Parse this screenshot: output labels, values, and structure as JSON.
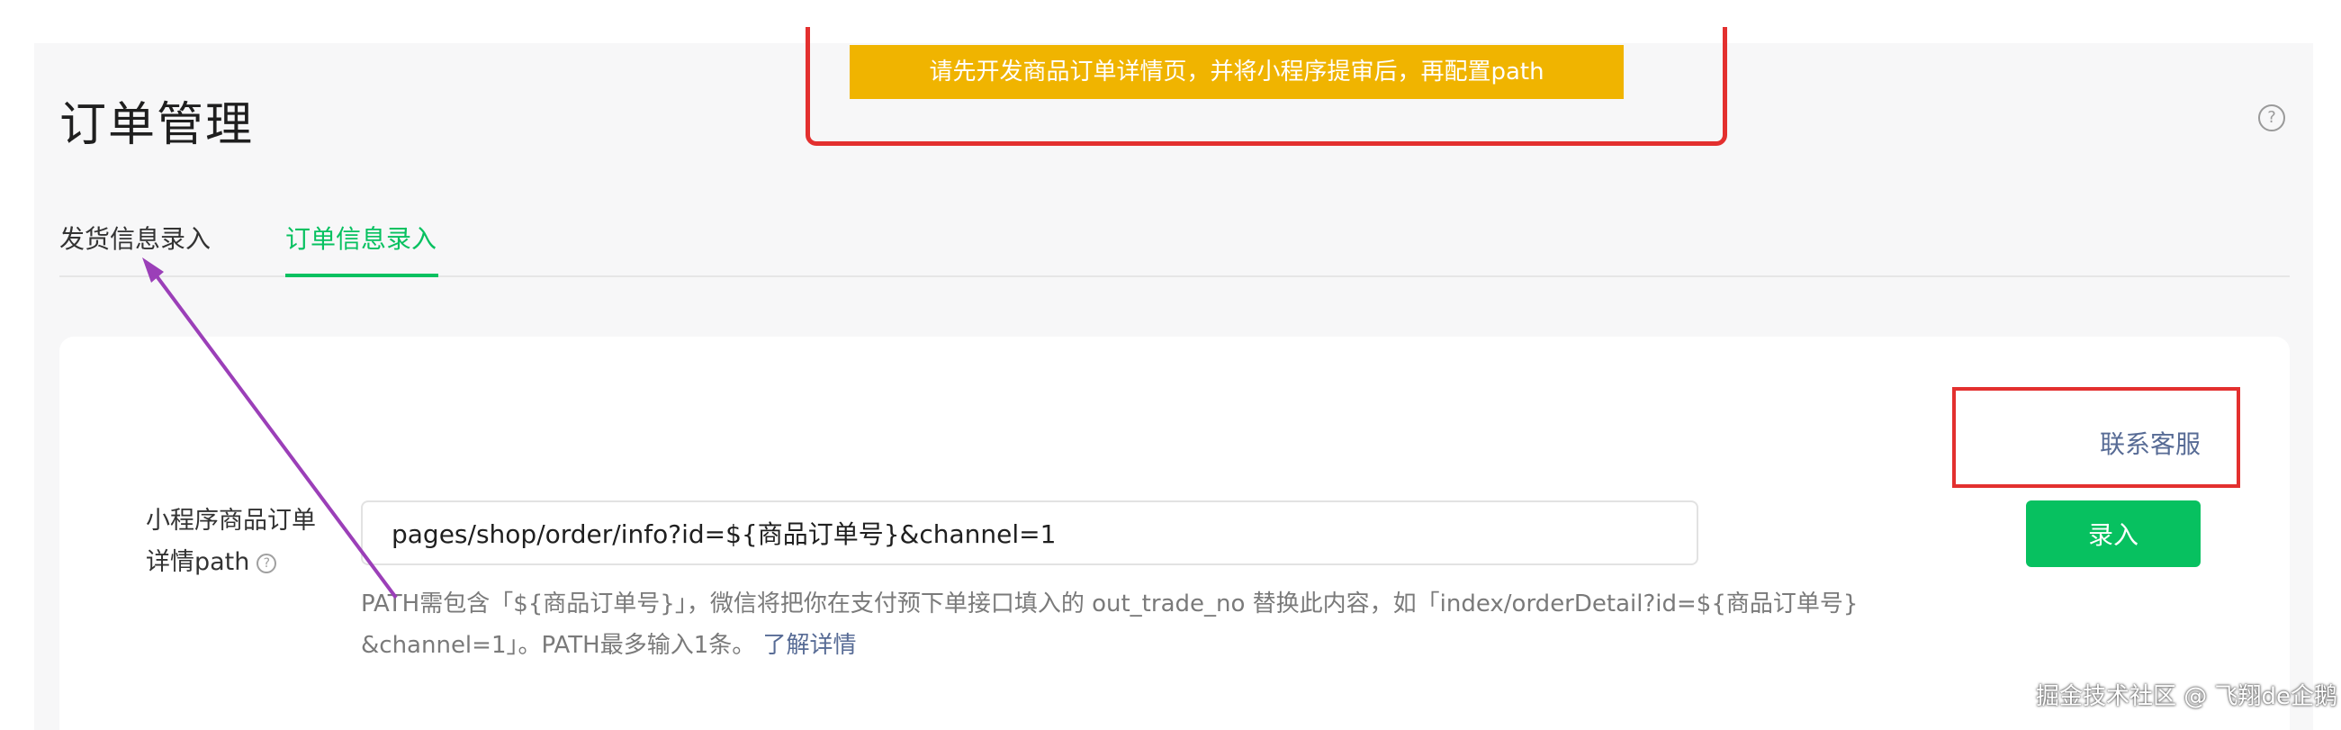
{
  "page": {
    "title": "订单管理",
    "help_icon": "question-circle-icon"
  },
  "notice": {
    "text": "请先开发商品订单详情页，并将小程序提审后，再配置path"
  },
  "tabs": [
    {
      "label": "发货信息录入",
      "active": false
    },
    {
      "label": "订单信息录入",
      "active": true
    }
  ],
  "contact": {
    "label": "联系客服"
  },
  "form": {
    "label_line1": "小程序商品订单",
    "label_line2": "详情path",
    "label_help_icon": "question-circle-icon",
    "path_value": "pages/shop/order/info?id=${商品订单号}&channel=1",
    "submit_label": "录入",
    "hint_line1": "PATH需包含「${商品订单号}」，微信将把你在支付预下单接口填入的 out_trade_no 替换此内容，如「index/orderDetail?id=${商品订单号}",
    "hint_line2": "&channel=1」。PATH最多输入1条。",
    "learn_more": "了解详情"
  },
  "watermark": {
    "text": "掘金技术社区 @ 飞翔de企鹅"
  },
  "colors": {
    "accent_green": "#07c160",
    "link_blue": "#576b95",
    "notice_yellow": "#f0b400",
    "annotation_red": "#e3302f",
    "annotation_purple": "#9b3fb8"
  }
}
